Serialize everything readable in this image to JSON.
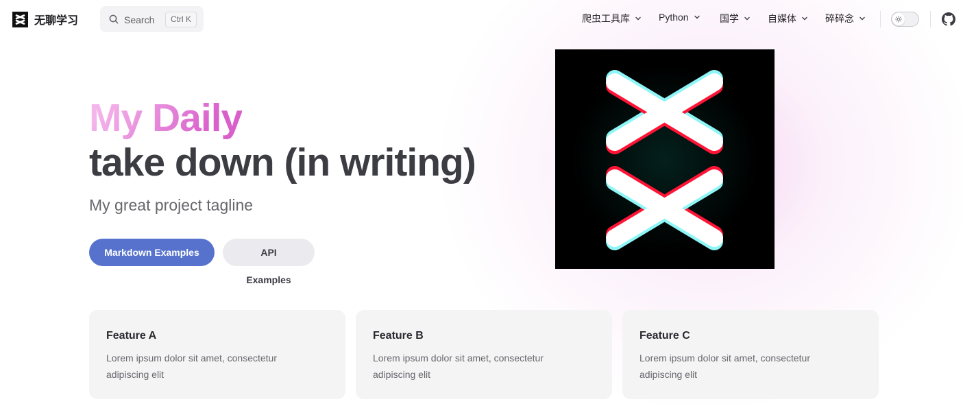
{
  "brand": {
    "name": "无聊学习",
    "logo": "xx-logo"
  },
  "search": {
    "label": "Search",
    "shortcut": "Ctrl K",
    "icon": "search-icon"
  },
  "nav": {
    "items": [
      {
        "label": "爬虫工具库",
        "icon": "chevron-down-icon"
      },
      {
        "label": "Python",
        "icon": "chevron-down-icon"
      },
      {
        "label": "国学",
        "icon": "chevron-down-icon"
      },
      {
        "label": "自媒体",
        "icon": "chevron-down-icon"
      },
      {
        "label": "碎碎念",
        "icon": "chevron-down-icon"
      }
    ],
    "theme_toggle": "sun-icon",
    "social": "github-icon"
  },
  "hero": {
    "name": "My Daily",
    "text": "take down (in writing)",
    "tagline": "My great project tagline",
    "actions": [
      {
        "label": "Markdown Examples",
        "theme": "brand"
      },
      {
        "label": "API Examples",
        "theme": "alt"
      }
    ]
  },
  "features": [
    {
      "title": "Feature A",
      "details": "Lorem ipsum dolor sit amet, consectetur adipiscing elit"
    },
    {
      "title": "Feature B",
      "details": "Lorem ipsum dolor sit amet, consectetur adipiscing elit"
    },
    {
      "title": "Feature C",
      "details": "Lorem ipsum dolor sit amet, consectetur adipiscing elit"
    }
  ],
  "colors": {
    "brand": "#5672cd",
    "name_gradient_start": "#f4b5ea",
    "name_gradient_end": "#d95fcb",
    "logo_cyan": "#8ef6f6",
    "logo_red": "#ff1436"
  }
}
